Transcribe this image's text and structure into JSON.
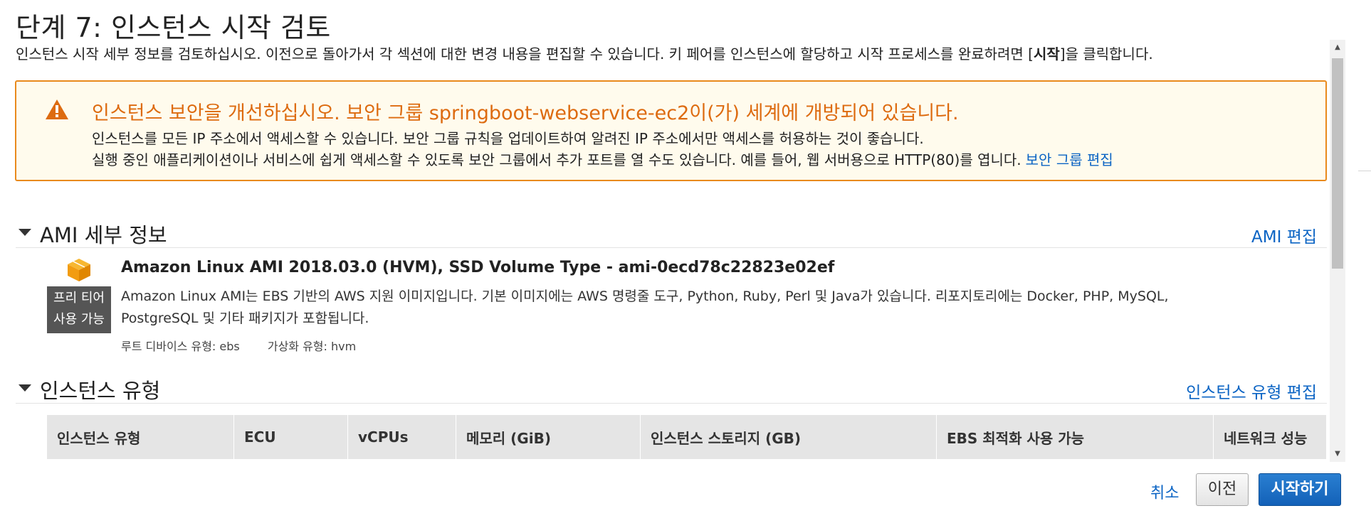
{
  "header": {
    "title": "단계 7: 인스턴스 시작 검토",
    "subtitle_before": "인스턴스 시작 세부 정보를 검토하십시오. 이전으로 돌아가서 각 섹션에 대한 변경 내용을 편집할 수 있습니다. 키 페어를 인스턴스에 할당하고 시작 프로세스를 완료하려면 [",
    "subtitle_bold": "시작",
    "subtitle_after": "]을 클릭합니다."
  },
  "warning": {
    "title": "인스턴스 보안을 개선하십시오. 보안 그룹 springboot-webservice-ec2이(가) 세계에 개방되어 있습니다.",
    "line1": "인스턴스를 모든 IP 주소에서 액세스할 수 있습니다. 보안 그룹 규칙을 업데이트하여 알려진 IP 주소에서만 액세스를 허용하는 것이 좋습니다.",
    "line2": "실행 중인 애플리케이션이나 서비스에 쉽게 액세스할 수 있도록 보안 그룹에서 추가 포트를 열 수도 있습니다. 예를 들어, 웹 서버용으로 HTTP(80)를 엽니다.",
    "link": "보안 그룹 편집",
    "icon": "warning-triangle-icon",
    "accent_color": "#dd6b10"
  },
  "ami": {
    "section_title": "AMI 세부 정보",
    "edit_link": "AMI 편집",
    "icon": "cube-icon",
    "badge_line1": "프리 티어",
    "badge_line2": "사용 가능",
    "name": "Amazon Linux AMI 2018.03.0 (HVM), SSD Volume Type - ami-0ecd78c22823e02ef",
    "description": "Amazon Linux AMI는 EBS 기반의 AWS 지원 이미지입니다. 기본 이미지에는 AWS 명령줄 도구, Python, Ruby, Perl 및 Java가 있습니다. 리포지토리에는 Docker, PHP, MySQL, PostgreSQL 및 기타 패키지가 포함됩니다.",
    "root_device": "루트 디바이스 유형: ebs",
    "virtualization": "가상화 유형: hvm"
  },
  "instance_type": {
    "section_title": "인스턴스 유형",
    "edit_link": "인스턴스 유형 편집",
    "columns": [
      "인스턴스 유형",
      "ECU",
      "vCPUs",
      "메모리 (GiB)",
      "인스턴스 스토리지 (GB)",
      "EBS 최적화 사용 가능",
      "네트워크 성능"
    ]
  },
  "footer": {
    "cancel": "취소",
    "previous": "이전",
    "launch": "시작하기",
    "primary_color": "#1361b8"
  }
}
